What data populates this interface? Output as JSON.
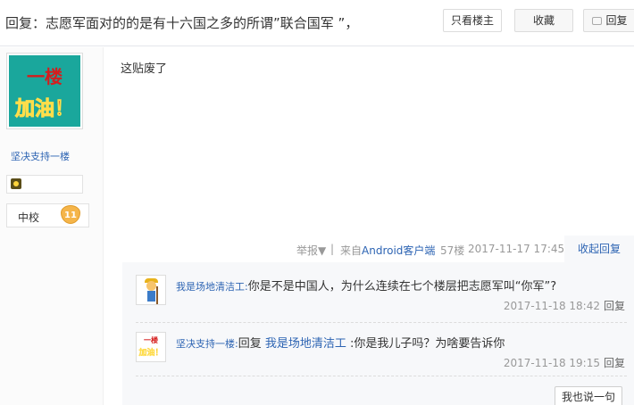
{
  "header": {
    "title": "回复：志愿军面对的的是有十六国之多的所谓”联合国军 ”，",
    "only_op_label": "只看楼主",
    "favorite_label": "收藏",
    "reply_label": "回复"
  },
  "author": {
    "avatar_line1": "一楼",
    "avatar_line2": "加油！",
    "name": "坚决支持一楼",
    "rank": "中校",
    "level": "11"
  },
  "post": {
    "content": "这贴废了",
    "report_label": "举报▼",
    "separator": "|",
    "source_prefix": "来自",
    "source_app": "Android客户端",
    "floor": "57楼",
    "time": "2017-11-17 17:45",
    "fold_label": "收起回复"
  },
  "replies": [
    {
      "user": "我是场地清洁工",
      "colon": ":",
      "text": "你是不是中国人，为什么连续在七个楼层把志愿军叫“你军”?",
      "time": "2017-11-18 18:42",
      "reply_label": "回复"
    },
    {
      "user": "坚决支持一楼",
      "colon": ":",
      "text_prefix": "回复 ",
      "target": "我是场地清洁工",
      "text": " :你是我儿子吗？为啥要告诉你",
      "time": "2017-11-18 19:15",
      "reply_label": "回复",
      "avatar_line1": "一楼",
      "avatar_line2": "加油！"
    }
  ],
  "say_button": "我也说一句",
  "colors": {
    "link": "#2d64b3",
    "meta": "#999999",
    "avatar_bg": "#1aa79c",
    "avatar_text": "#d51d1d"
  },
  "icons": [
    "comment-icon",
    "report-dropdown-icon",
    "forum-badge-icon",
    "level-badge-icon"
  ]
}
